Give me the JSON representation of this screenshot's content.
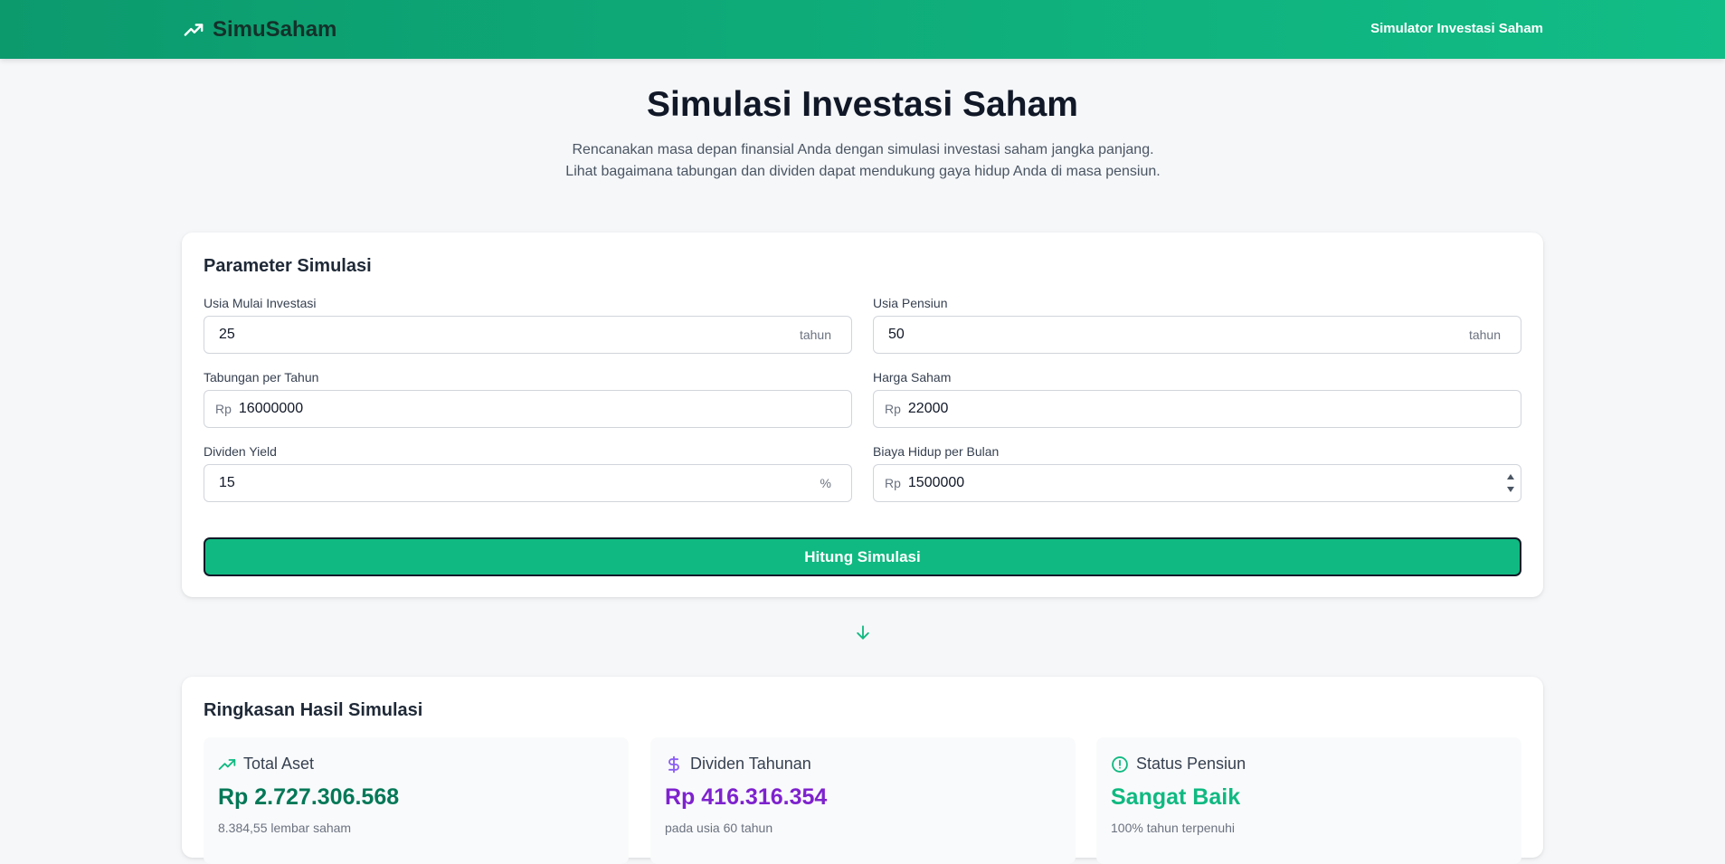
{
  "brand": {
    "name": "SimuSaham",
    "icon": "trending-up-icon"
  },
  "nav": {
    "link": "Simulator Investasi Saham"
  },
  "hero": {
    "title": "Simulasi Investasi Saham",
    "subtitle": "Rencanakan masa depan finansial Anda dengan simulasi investasi saham jangka panjang. Lihat bagaimana tabungan dan dividen dapat mendukung gaya hidup Anda di masa pensiun."
  },
  "params": {
    "title": "Parameter Simulasi",
    "fields": [
      {
        "label": "Usia Mulai Investasi",
        "value": "25",
        "prefix": "",
        "suffix": "tahun"
      },
      {
        "label": "Usia Pensiun",
        "value": "50",
        "prefix": "",
        "suffix": "tahun"
      },
      {
        "label": "Tabungan per Tahun",
        "value": "16000000",
        "prefix": "Rp",
        "suffix": ""
      },
      {
        "label": "Harga Saham",
        "value": "22000",
        "prefix": "Rp",
        "suffix": ""
      },
      {
        "label": "Dividen Yield",
        "value": "15",
        "prefix": "",
        "suffix": "%"
      },
      {
        "label": "Biaya Hidup per Bulan",
        "value": "1500000",
        "prefix": "Rp",
        "suffix": ""
      }
    ],
    "button": "Hitung Simulasi"
  },
  "results": {
    "title": "Ringkasan Hasil Simulasi",
    "stats": [
      {
        "label": "Total Aset",
        "value": "Rp 2.727.306.568",
        "note": "8.384,55 lembar saham",
        "icon": "trending-up-icon",
        "color": "#047857"
      },
      {
        "label": "Dividen Tahunan",
        "value": "Rp 416.316.354",
        "note": "pada usia 60 tahun",
        "icon": "dollar-icon",
        "color": "#7e22ce"
      },
      {
        "label": "Status Pensiun",
        "value": "Sangat Baik",
        "note": "100% tahun terpenuhi",
        "icon": "alert-circle-icon",
        "color": "#10b981"
      }
    ]
  },
  "colors": {
    "primary": "#10b981",
    "navbar": "#0fb07c",
    "background": "#f5f7f9"
  }
}
